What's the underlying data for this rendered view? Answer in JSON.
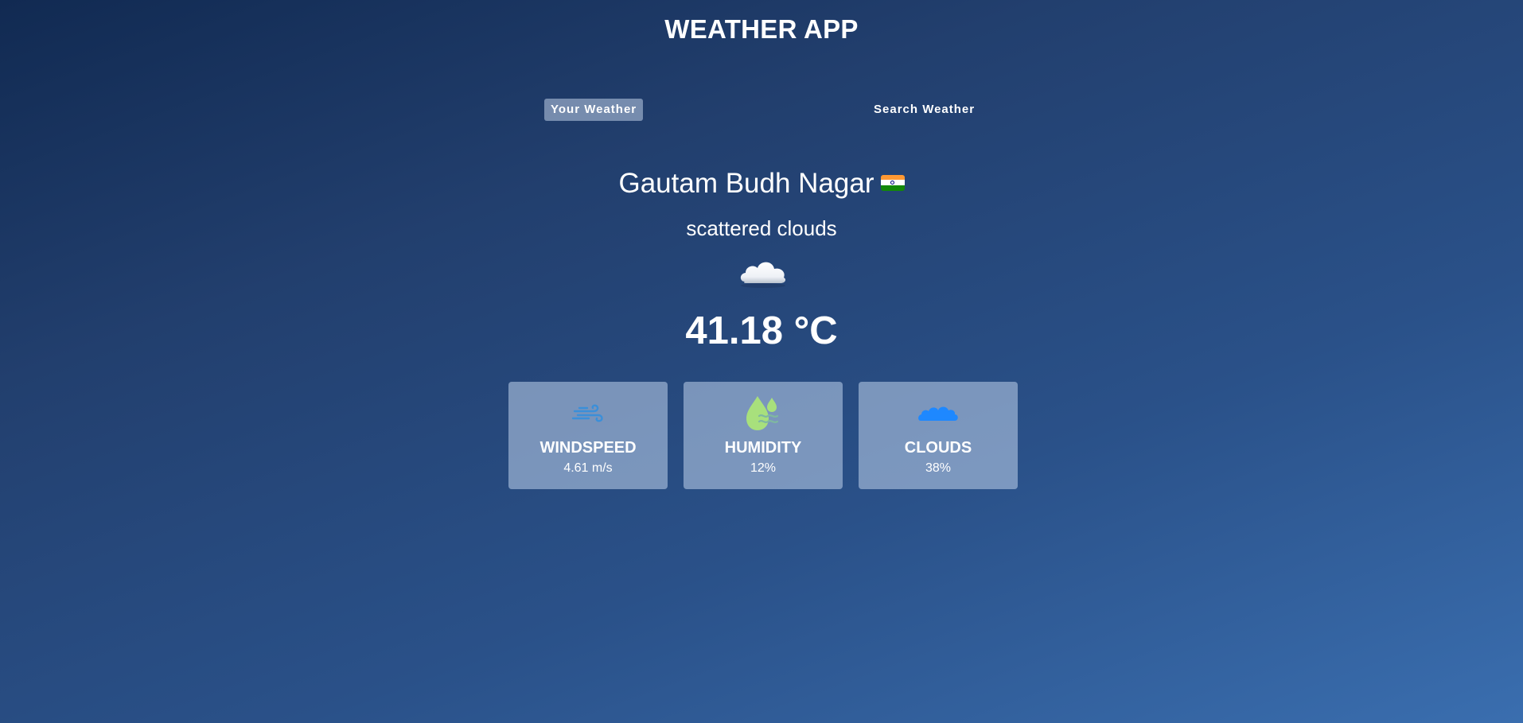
{
  "app": {
    "title": "WEATHER APP"
  },
  "tabs": [
    {
      "label": "Your Weather",
      "active": true
    },
    {
      "label": "Search Weather",
      "active": false
    }
  ],
  "weather": {
    "city": "Gautam Budh Nagar",
    "country_flag_icon": "india-flag-icon",
    "description": "scattered clouds",
    "condition_icon": "cloud-icon",
    "temperature": "41.18 °C"
  },
  "stats": [
    {
      "label": "WINDSPEED",
      "value": "4.61 m/s",
      "icon": "wind-icon",
      "icon_color": "#3b8fd9"
    },
    {
      "label": "HUMIDITY",
      "value": "12%",
      "icon": "humidity-drop-icon",
      "icon_color": "#a8e07c"
    },
    {
      "label": "CLOUDS",
      "value": "38%",
      "icon": "clouds-icon",
      "icon_color": "#1e88ff"
    }
  ],
  "colors": {
    "background_top": "#112a52",
    "background_bottom": "#3a6eaf",
    "card_background": "#afc3e1",
    "active_tab_background": "#bfcde6",
    "text": "#ffffff"
  }
}
